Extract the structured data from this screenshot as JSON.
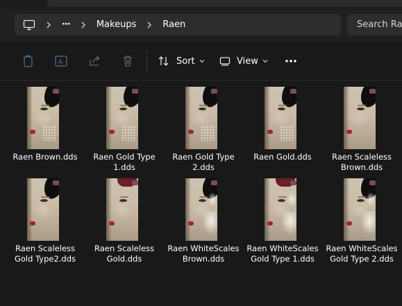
{
  "breadcrumb": {
    "root_icon": "computer-icon",
    "overflow": "···",
    "items": [
      "Makeups",
      "Raen"
    ]
  },
  "search": {
    "placeholder": "Search Raen"
  },
  "toolbar": {
    "icons": [
      "copy-icon",
      "rename-icon",
      "share-icon",
      "delete-icon"
    ],
    "sort_label": "Sort",
    "view_label": "View",
    "more_label": "···"
  },
  "files": [
    {
      "line1": "Raen Brown.dds",
      "line2": ""
    },
    {
      "line1": "Raen Gold Type",
      "line2": "1.dds"
    },
    {
      "line1": "Raen Gold Type",
      "line2": "2.dds"
    },
    {
      "line1": "Raen Gold.dds",
      "line2": ""
    },
    {
      "line1": "Raen Scaleless",
      "line2": "Brown.dds"
    },
    {
      "line1": "Raen Scaleless",
      "line2": "Gold Type2.dds"
    },
    {
      "line1": "Raen Scaleless",
      "line2": "Gold.dds"
    },
    {
      "line1": "Raen WhiteScales",
      "line2": "Brown.dds"
    },
    {
      "line1": "Raen WhiteScales",
      "line2": "Gold Type 1.dds"
    },
    {
      "line1": "Raen WhiteScales",
      "line2": "Gold Type 2.dds"
    }
  ],
  "colors": {
    "background": "#191919",
    "bar": "#2d2d2d",
    "text": "#ffffff",
    "disabled_icon": "#4f6f91"
  }
}
